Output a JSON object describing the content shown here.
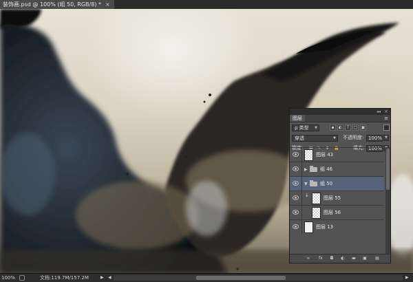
{
  "document_tab": {
    "title": "装饰画.psd @ 100% (组 50, RGB/8) *",
    "close": "×"
  },
  "layers_panel": {
    "tab_label": "图层",
    "collapse_glyph": "◂◂",
    "close_glyph": "×",
    "menu_glyph": "≡",
    "filter": {
      "label": "ρ 类型"
    },
    "blend_mode": "穿透",
    "opacity_label": "不透明度:",
    "opacity_value": "100%",
    "lock_label": "锁定:",
    "fill_label": "填充:",
    "fill_value": "100%",
    "layers": [
      {
        "name": "图层 43",
        "type": "layer",
        "visible": true,
        "selected": false,
        "indent": 0
      },
      {
        "name": "组 46",
        "type": "group",
        "visible": true,
        "selected": false,
        "indent": 0,
        "expanded": false
      },
      {
        "name": "组 50",
        "type": "group",
        "visible": true,
        "selected": true,
        "indent": 0,
        "expanded": true
      },
      {
        "name": "图层 55",
        "type": "layer",
        "visible": true,
        "selected": false,
        "indent": 1,
        "clipped": true
      },
      {
        "name": "图层 56",
        "type": "layer",
        "visible": true,
        "selected": false,
        "indent": 1
      },
      {
        "name": "图层 13",
        "type": "layer",
        "visible": true,
        "selected": false,
        "indent": 0,
        "solid": true
      }
    ],
    "footer_icons": [
      "link-icon",
      "fx-icon",
      "mask-icon",
      "adjustment-icon",
      "folder-icon",
      "new-layer-icon",
      "trash-icon"
    ],
    "footer_glyphs": {
      "link": "∞",
      "fx": "fx",
      "mask": "◘",
      "adjust": "◐",
      "folder": "▬",
      "new": "▣",
      "trash": "▤"
    }
  },
  "status_bar": {
    "zoom": "100%",
    "doc_size": "文档:119.7M/157.2M",
    "arrow": "▶",
    "scroll_left": "◀",
    "scroll_right": "▶"
  },
  "colors": {
    "selection": "#56637a",
    "panel": "#535353",
    "ink": "#1c1c1c"
  }
}
